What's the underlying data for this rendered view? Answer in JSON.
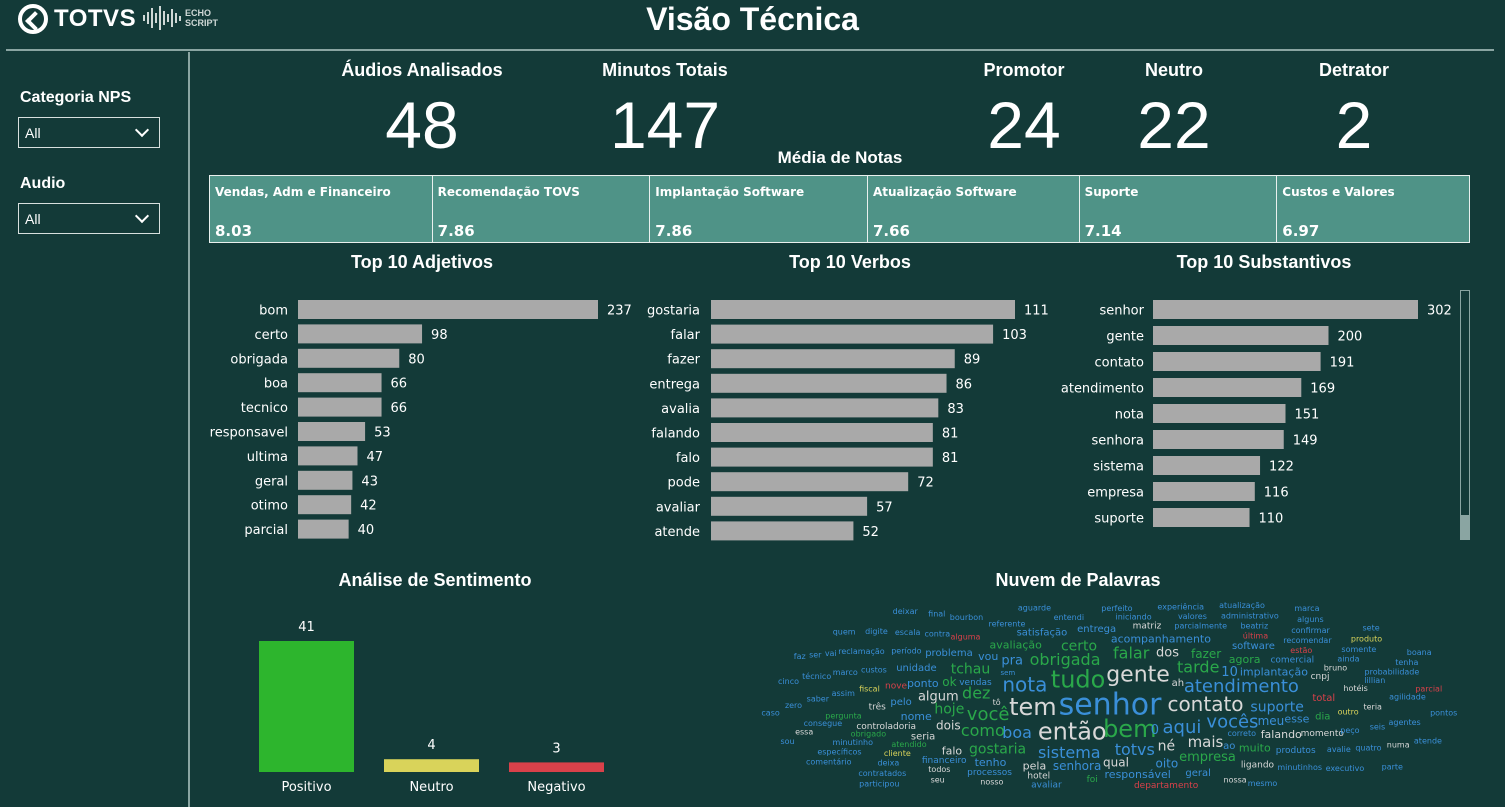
{
  "header": {
    "brand": "TOTVS",
    "echo_top": "ECHO",
    "echo_bottom": "SCRIPT",
    "title": "Visão Técnica"
  },
  "filters": [
    {
      "label": "Categoria NPS",
      "value": "All"
    },
    {
      "label": "Audio",
      "value": "All"
    }
  ],
  "kpis": {
    "audios": {
      "label": "Áudios Analisados",
      "value": "48"
    },
    "minutos": {
      "label": "Minutos Totais",
      "value": "147"
    },
    "promotor": {
      "label": "Promotor",
      "value": "24"
    },
    "neutro": {
      "label": "Neutro",
      "value": "22"
    },
    "detrator": {
      "label": "Detrator",
      "value": "2"
    }
  },
  "media_notas": {
    "title": "Média de Notas",
    "cards": [
      {
        "name": "Vendas, Adm e Financeiro",
        "value": "8.03"
      },
      {
        "name": "Recomendação TOVS",
        "value": "7.86"
      },
      {
        "name": "Implantação Software",
        "value": "7.86"
      },
      {
        "name": "Atualização Software",
        "value": "7.66"
      },
      {
        "name": "Suporte",
        "value": "7.14"
      },
      {
        "name": "Custos e Valores",
        "value": "6.97"
      }
    ]
  },
  "chart_data": [
    {
      "type": "bar",
      "orientation": "horizontal",
      "title": "Top 10 Adjetivos",
      "categories": [
        "bom",
        "certo",
        "obrigada",
        "boa",
        "tecnico",
        "responsavel",
        "ultima",
        "geral",
        "otimo",
        "parcial"
      ],
      "values": [
        237,
        98,
        80,
        66,
        66,
        53,
        47,
        43,
        42,
        40
      ],
      "color": "#a9a9a9"
    },
    {
      "type": "bar",
      "orientation": "horizontal",
      "title": "Top 10 Verbos",
      "categories": [
        "gostaria",
        "falar",
        "fazer",
        "entrega",
        "avalia",
        "falando",
        "falo",
        "pode",
        "avaliar",
        "atende"
      ],
      "values": [
        111,
        103,
        89,
        86,
        83,
        81,
        81,
        72,
        57,
        52
      ],
      "color": "#a9a9a9"
    },
    {
      "type": "bar",
      "orientation": "horizontal",
      "title": "Top 10 Substantivos",
      "categories": [
        "senhor",
        "gente",
        "contato",
        "atendimento",
        "nota",
        "senhora",
        "sistema",
        "empresa",
        "suporte"
      ],
      "values": [
        302,
        200,
        191,
        169,
        151,
        149,
        122,
        116,
        110
      ],
      "color": "#a9a9a9"
    },
    {
      "type": "bar",
      "orientation": "vertical",
      "title": "Análise de Sentimento",
      "categories": [
        "Positivo",
        "Neutro",
        "Negativo"
      ],
      "values": [
        41,
        4,
        3
      ],
      "colors": [
        "#2db52d",
        "#d9d35a",
        "#d9414a"
      ]
    }
  ],
  "word_cloud": {
    "title": "Nuvem de Palavras",
    "words": [
      {
        "t": "senhor",
        "c": "#3a8fd8",
        "s": 30
      },
      {
        "t": "bem",
        "c": "#2aa84a",
        "s": 24
      },
      {
        "t": "tudo",
        "c": "#2aa84a",
        "s": 24
      },
      {
        "t": "então",
        "c": "#d8d8d8",
        "s": 24
      },
      {
        "t": "gente",
        "c": "#d8d8d8",
        "s": 22
      },
      {
        "t": "contato",
        "c": "#d8d8d8",
        "s": 20
      },
      {
        "t": "tem",
        "c": "#d8d8d8",
        "s": 24
      },
      {
        "t": "nota",
        "c": "#3a8fd8",
        "s": 20
      },
      {
        "t": "aqui",
        "c": "#3a8fd8",
        "s": 18
      },
      {
        "t": "atendimento",
        "c": "#3a8fd8",
        "s": 18
      },
      {
        "t": "você",
        "c": "#2aa84a",
        "s": 18
      },
      {
        "t": "vocês",
        "c": "#3a8fd8",
        "s": 18
      },
      {
        "t": "totvs",
        "c": "#3a8fd8",
        "s": 16
      },
      {
        "t": "obrigada",
        "c": "#2aa84a",
        "s": 16
      },
      {
        "t": "boa",
        "c": "#3a8fd8",
        "s": 16
      },
      {
        "t": "sistema",
        "c": "#3a8fd8",
        "s": 16
      },
      {
        "t": "dez",
        "c": "#2aa84a",
        "s": 16
      },
      {
        "t": "tarde",
        "c": "#2aa84a",
        "s": 16
      },
      {
        "t": "falar",
        "c": "#2aa84a",
        "s": 16
      },
      {
        "t": "como",
        "c": "#2aa84a",
        "s": 16
      },
      {
        "t": "mais",
        "c": "#d8d8d8",
        "s": 15
      },
      {
        "t": "né",
        "c": "#d8d8d8",
        "s": 14
      },
      {
        "t": "hoje",
        "c": "#2aa84a",
        "s": 14
      },
      {
        "t": "suporte",
        "c": "#3a8fd8",
        "s": 14
      },
      {
        "t": "empresa",
        "c": "#2aa84a",
        "s": 13
      },
      {
        "t": "gostaria",
        "c": "#2aa84a",
        "s": 14
      },
      {
        "t": "tchau",
        "c": "#2aa84a",
        "s": 14
      },
      {
        "t": "certo",
        "c": "#2aa84a",
        "s": 14
      },
      {
        "t": "algum",
        "c": "#d8d8d8",
        "s": 13
      },
      {
        "t": "pra",
        "c": "#3a8fd8",
        "s": 13
      },
      {
        "t": "dos",
        "c": "#d8d8d8",
        "s": 13
      },
      {
        "t": "qual",
        "c": "#d8d8d8",
        "s": 12
      },
      {
        "t": "fazer",
        "c": "#2aa84a",
        "s": 12
      },
      {
        "t": "dois",
        "c": "#d8d8d8",
        "s": 12
      },
      {
        "t": "meu",
        "c": "#3a8fd8",
        "s": 12
      },
      {
        "t": "senhora",
        "c": "#3a8fd8",
        "s": 12
      },
      {
        "t": "implantação",
        "c": "#3a8fd8",
        "s": 11
      },
      {
        "t": "avaliação",
        "c": "#2aa84a",
        "s": 11
      },
      {
        "t": "falando",
        "c": "#d8d8d8",
        "s": 11
      },
      {
        "t": "acompanhamento",
        "c": "#3a8fd8",
        "s": 11
      },
      {
        "t": "responsável",
        "c": "#3a8fd8",
        "s": 11
      },
      {
        "t": "agora",
        "c": "#2aa84a",
        "s": 11
      },
      {
        "t": "muito",
        "c": "#2aa84a",
        "s": 11
      },
      {
        "t": "seria",
        "c": "#d8d8d8",
        "s": 10
      },
      {
        "t": "esse",
        "c": "#3a8fd8",
        "s": 11
      },
      {
        "t": "pelo",
        "c": "#3a8fd8",
        "s": 10
      },
      {
        "t": "unidade",
        "c": "#3a8fd8",
        "s": 10
      },
      {
        "t": "problema",
        "c": "#3a8fd8",
        "s": 10
      },
      {
        "t": "satisfação",
        "c": "#3a8fd8",
        "s": 10
      },
      {
        "t": "vou",
        "c": "#3a8fd8",
        "s": 11
      },
      {
        "t": "total",
        "c": "#d9414a",
        "s": 10
      },
      {
        "t": "entrega",
        "c": "#3a8fd8",
        "s": 10
      },
      {
        "t": "oito",
        "c": "#3a8fd8",
        "s": 12
      },
      {
        "t": "ok",
        "c": "#2aa84a",
        "s": 12
      },
      {
        "t": "software",
        "c": "#3a8fd8",
        "s": 10
      },
      {
        "t": "comercial",
        "c": "#3a8fd8",
        "s": 9
      },
      {
        "t": "produtos",
        "c": "#3a8fd8",
        "s": 9
      },
      {
        "t": "vendas",
        "c": "#3a8fd8",
        "s": 9
      },
      {
        "t": "geral",
        "c": "#3a8fd8",
        "s": 10
      },
      {
        "t": "ah",
        "c": "#d8d8d8",
        "s": 10
      },
      {
        "t": "pela",
        "c": "#d8d8d8",
        "s": 11
      },
      {
        "t": "hotel",
        "c": "#d8d8d8",
        "s": 9
      },
      {
        "t": "controladoria",
        "c": "#d8d8d8",
        "s": 9
      },
      {
        "t": "momento",
        "c": "#d8d8d8",
        "s": 9
      },
      {
        "t": "ligando",
        "c": "#d8d8d8",
        "s": 9
      },
      {
        "t": "processos",
        "c": "#3a8fd8",
        "s": 9
      },
      {
        "t": "financeiro",
        "c": "#3a8fd8",
        "s": 9
      },
      {
        "t": "atendido",
        "c": "#2aa84a",
        "s": 8
      },
      {
        "t": "parcialmente",
        "c": "#3a8fd8",
        "s": 8
      },
      {
        "t": "correto",
        "c": "#3a8fd8",
        "s": 8
      },
      {
        "t": "outro",
        "c": "#d9d35a",
        "s": 8
      },
      {
        "t": "fiscal",
        "c": "#d9d35a",
        "s": 8
      },
      {
        "t": "nove",
        "c": "#d9414a",
        "s": 9
      },
      {
        "t": "alguma",
        "c": "#d9414a",
        "s": 8
      },
      {
        "t": "departamento",
        "c": "#d9414a",
        "s": 9
      },
      {
        "t": "última",
        "c": "#d9414a",
        "s": 8
      },
      {
        "t": "estão",
        "c": "#d9414a",
        "s": 8
      },
      {
        "t": "bruno",
        "c": "#d8d8d8",
        "s": 8
      },
      {
        "t": "hotéis",
        "c": "#d8d8d8",
        "s": 8
      },
      {
        "t": "matriz",
        "c": "#d8d8d8",
        "s": 9
      },
      {
        "t": "cnpj",
        "c": "#d8d8d8",
        "s": 9
      },
      {
        "t": "nossa",
        "c": "#d8d8d8",
        "s": 8
      },
      {
        "t": "nosso",
        "c": "#d8d8d8",
        "s": 8
      },
      {
        "t": "todos",
        "c": "#d8d8d8",
        "s": 8
      },
      {
        "t": "cliente",
        "c": "#d9d35a",
        "s": 8
      },
      {
        "t": "obrigado",
        "c": "#2aa84a",
        "s": 8
      },
      {
        "t": "custos",
        "c": "#3a8fd8",
        "s": 8
      },
      {
        "t": "período",
        "c": "#3a8fd8",
        "s": 8
      },
      {
        "t": "peço",
        "c": "#3a8fd8",
        "s": 8
      },
      {
        "t": "referente",
        "c": "#3a8fd8",
        "s": 8
      },
      {
        "t": "entendi",
        "c": "#3a8fd8",
        "s": 8
      },
      {
        "t": "iniciando",
        "c": "#3a8fd8",
        "s": 8
      },
      {
        "t": "minutinhos",
        "c": "#3a8fd8",
        "s": 8
      },
      {
        "t": "avalie",
        "c": "#3a8fd8",
        "s": 8
      },
      {
        "t": "pergunta",
        "c": "#2aa84a",
        "s": 8
      },
      {
        "t": "teria",
        "c": "#d8d8d8",
        "s": 8
      },
      {
        "t": "valores",
        "c": "#3a8fd8",
        "s": 8
      },
      {
        "t": "beatriz",
        "c": "#3a8fd8",
        "s": 8
      },
      {
        "t": "contra",
        "c": "#3a8fd8",
        "s": 8
      },
      {
        "t": "recomendar",
        "c": "#3a8fd8",
        "s": 8
      },
      {
        "t": "assim",
        "c": "#3a8fd8",
        "s": 8
      },
      {
        "t": "ainda",
        "c": "#3a8fd8",
        "s": 8
      },
      {
        "t": "lillian",
        "c": "#3a8fd8",
        "s": 8
      },
      {
        "t": "seis",
        "c": "#3a8fd8",
        "s": 8
      },
      {
        "t": "mesmo",
        "c": "#3a8fd8",
        "s": 8
      },
      {
        "t": "seu",
        "c": "#d8d8d8",
        "s": 8
      },
      {
        "t": "deixa",
        "c": "#3a8fd8",
        "s": 8
      },
      {
        "t": "minutinho",
        "c": "#3a8fd8",
        "s": 8
      },
      {
        "t": "perfeito",
        "c": "#3a8fd8",
        "s": 8
      },
      {
        "t": "marco",
        "c": "#3a8fd8",
        "s": 8
      },
      {
        "t": "consegue",
        "c": "#3a8fd8",
        "s": 8
      },
      {
        "t": "reclamação",
        "c": "#3a8fd8",
        "s": 8
      },
      {
        "t": "bourbon",
        "c": "#3a8fd8",
        "s": 8
      },
      {
        "t": "aguarde",
        "c": "#3a8fd8",
        "s": 8
      },
      {
        "t": "quatro",
        "c": "#3a8fd8",
        "s": 8
      },
      {
        "t": "escala",
        "c": "#3a8fd8",
        "s": 8
      },
      {
        "t": "experiência",
        "c": "#3a8fd8",
        "s": 8
      },
      {
        "t": "administrativo",
        "c": "#3a8fd8",
        "s": 8
      },
      {
        "t": "confirmar",
        "c": "#3a8fd8",
        "s": 8
      },
      {
        "t": "somente",
        "c": "#3a8fd8",
        "s": 8
      },
      {
        "t": "probabilidade",
        "c": "#3a8fd8",
        "s": 8
      },
      {
        "t": "agilidade",
        "c": "#3a8fd8",
        "s": 8
      },
      {
        "t": "agentes",
        "c": "#3a8fd8",
        "s": 8
      },
      {
        "t": "executivo",
        "c": "#3a8fd8",
        "s": 8
      },
      {
        "t": "contratados",
        "c": "#3a8fd8",
        "s": 8
      },
      {
        "t": "específicos",
        "c": "#3a8fd8",
        "s": 8
      },
      {
        "t": "saber",
        "c": "#3a8fd8",
        "s": 8
      },
      {
        "t": "técnico",
        "c": "#3a8fd8",
        "s": 8
      },
      {
        "t": "numa",
        "c": "#d8d8d8",
        "s": 8
      },
      {
        "t": "essa",
        "c": "#d8d8d8",
        "s": 8
      },
      {
        "t": "digite",
        "c": "#3a8fd8",
        "s": 8
      },
      {
        "t": "atualização",
        "c": "#3a8fd8",
        "s": 8
      },
      {
        "t": "tô",
        "c": "#d8d8d8",
        "s": 8
      },
      {
        "t": "alguns",
        "c": "#3a8fd8",
        "s": 8
      },
      {
        "t": "zero",
        "c": "#3a8fd8",
        "s": 8
      },
      {
        "t": "vai",
        "c": "#3a8fd8",
        "s": 8
      },
      {
        "t": "produto",
        "c": "#d9d35a",
        "s": 8
      },
      {
        "t": "três",
        "c": "#d8d8d8",
        "s": 9
      },
      {
        "t": "final",
        "c": "#3a8fd8",
        "s": 8
      },
      {
        "t": "tenha",
        "c": "#3a8fd8",
        "s": 8
      },
      {
        "t": "parcial",
        "c": "#d9414a",
        "s": 8
      },
      {
        "t": "participou",
        "c": "#3a8fd8",
        "s": 8
      },
      {
        "t": "comentário",
        "c": "#3a8fd8",
        "s": 8
      },
      {
        "t": "pontos",
        "c": "#3a8fd8",
        "s": 8
      },
      {
        "t": "atende",
        "c": "#3a8fd8",
        "s": 8
      },
      {
        "t": "cinco",
        "c": "#3a8fd8",
        "s": 8
      },
      {
        "t": "parte",
        "c": "#3a8fd8",
        "s": 8
      },
      {
        "t": "ser",
        "c": "#3a8fd8",
        "s": 8
      },
      {
        "t": "sou",
        "c": "#3a8fd8",
        "s": 8
      },
      {
        "t": "dia",
        "c": "#2aa84a",
        "s": 10
      },
      {
        "t": "ao",
        "c": "#3a8fd8",
        "s": 10
      },
      {
        "t": "foi",
        "c": "#2aa84a",
        "s": 9
      },
      {
        "t": "10",
        "c": "#3a8fd8",
        "s": 13
      },
      {
        "t": "0",
        "c": "#3a8fd8",
        "s": 13
      },
      {
        "t": "nome",
        "c": "#3a8fd8",
        "s": 11
      },
      {
        "t": "ponto",
        "c": "#3a8fd8",
        "s": 11
      },
      {
        "t": "tenho",
        "c": "#3a8fd8",
        "s": 11
      },
      {
        "t": "falo",
        "c": "#d8d8d8",
        "s": 11
      },
      {
        "t": "caso",
        "c": "#3a8fd8",
        "s": 8
      },
      {
        "t": "quem",
        "c": "#3a8fd8",
        "s": 8
      },
      {
        "t": "deixar",
        "c": "#3a8fd8",
        "s": 8
      },
      {
        "t": "avaliar",
        "c": "#3a8fd8",
        "s": 9
      },
      {
        "t": "marca",
        "c": "#3a8fd8",
        "s": 8
      },
      {
        "t": "sem",
        "c": "#3a8fd8",
        "s": 7
      },
      {
        "t": "sete",
        "c": "#3a8fd8",
        "s": 8
      },
      {
        "t": "faz",
        "c": "#3a8fd8",
        "s": 8
      },
      {
        "t": "boana",
        "c": "#3a8fd8",
        "s": 8
      }
    ]
  }
}
